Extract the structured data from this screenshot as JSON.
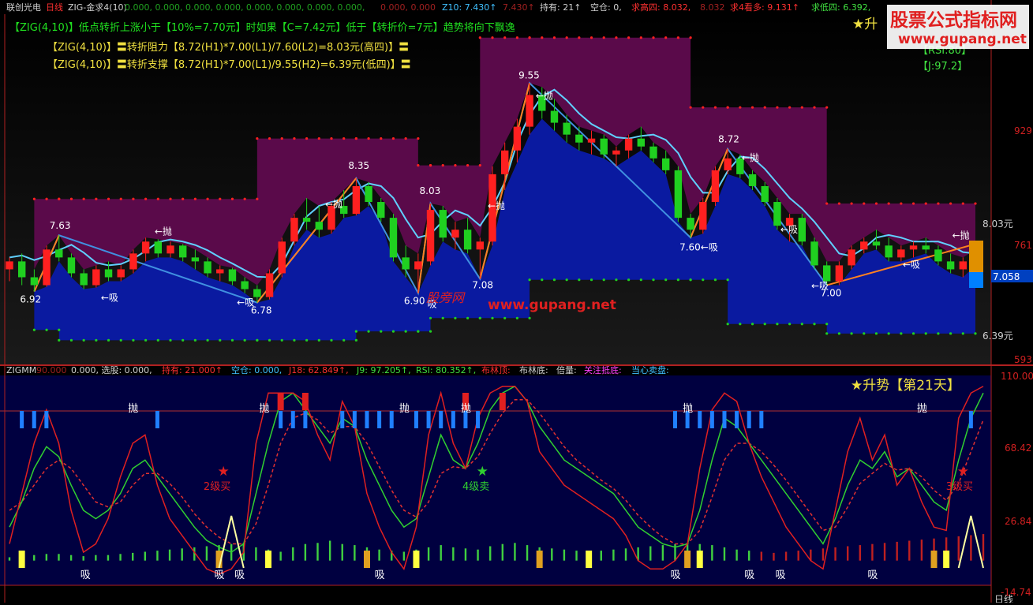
{
  "window": {
    "app_title": "联创光电",
    "period": "日线",
    "indicator_name": "ZIG-金求4(10)"
  },
  "top_bar": {
    "zero_values": "0.000, 0.000, 0.000, 0.000, 0.000, 0.000, 0.000, 0.000,",
    "zero_value_red": "0.000, 0.000",
    "z10": "Z10: 7.430↑",
    "z10_b": "7.430↑",
    "holding": "持有: 21↑",
    "empty": "空仓: 0,",
    "qiu_gao_si": "求高四: 8.032,",
    "qiu_gao_si_b": "8.032",
    "qiu_kan_duo": "求4看多: 9.131↑",
    "qiu_di_si": "求低四: 6.392,"
  },
  "watermark": {
    "title": "股票公式指标网",
    "url": "www.gupang.net",
    "mid_text": "股旁网",
    "mid_url": "www.gupang.net"
  },
  "notes": {
    "line1": "【ZIG(4,10)】低点转折上涨小于【10%=7.70元】时如果【C=7.42元】低于【转折价=7元】趋势将向下飘逸",
    "line2": "【ZIG(4,10)】〓转折阻力【8.72(H1)*7.00(L1)/7.60(L2)=8.03元(高四)】〓",
    "line3": "【ZIG(4,10)】〓转折支撑【8.72(H1)*7.00(L1)/9.55(H2)=6.39元(低四)】〓",
    "star_upper": "★升",
    "rsi": "【RSI:80】",
    "j": "【J:97.2】"
  },
  "right_axis_upper": {
    "val_929": "929",
    "val_803": "8.03元",
    "val_761": "761",
    "val_7058": "7.058",
    "val_639": "6.39元",
    "val_593": "593"
  },
  "lower_panel": {
    "name": "ZIGMM",
    "v90": "90.000",
    "xuangu": "0.000, 选股: 0.000,",
    "chiyou": "持有: 21.000↑",
    "kongcang": "空仓: 0.000,",
    "j18": "J18: 62.849↑,",
    "j9": "J9: 97.205↑,",
    "rsi": "RSI: 80.352↑,",
    "bulin_ding": "布林顶:",
    "bulin_di": "布林底:",
    "beiliang": "倍量:",
    "guanzhu": "关注抵底:",
    "dangxin": "当心卖盘:",
    "status": "★升势【第21天】",
    "axis_110": "110.00",
    "axis_6842": "68.42",
    "axis_2684": "26.84",
    "axis_neg": "-14.74",
    "bottom_right": "日线"
  },
  "labels_upper": [
    {
      "text": "7.63",
      "color": "#ffffff"
    },
    {
      "text": "6.92",
      "color": "#ffffff"
    },
    {
      "text": "←抛",
      "color": "#ffffff"
    },
    {
      "text": "←吸",
      "color": "#ffffff"
    },
    {
      "text": "6.78",
      "color": "#ffffff"
    },
    {
      "text": "←吸",
      "color": "#ffffff"
    },
    {
      "text": "8.35",
      "color": "#ffffff"
    },
    {
      "text": "←抛",
      "color": "#ffffff"
    },
    {
      "text": "8.03",
      "color": "#ffffff"
    },
    {
      "text": "6.90",
      "color": "#ffffff"
    },
    {
      "text": "吸",
      "color": "#ffffff"
    },
    {
      "text": "←抛",
      "color": "#ffffff"
    },
    {
      "text": "7.08",
      "color": "#ffffff"
    },
    {
      "text": "9.55",
      "color": "#ffffff"
    },
    {
      "text": "←抛",
      "color": "#ffffff"
    },
    {
      "text": "7.60←吸",
      "color": "#ffffff"
    },
    {
      "text": "8.72",
      "color": "#ffffff"
    },
    {
      "text": "←抛",
      "color": "#ffffff"
    },
    {
      "text": "←吸",
      "color": "#ffffff"
    },
    {
      "text": "←吸",
      "color": "#ffffff"
    },
    {
      "text": "7.00",
      "color": "#ffffff"
    },
    {
      "text": "←吸",
      "color": "#ffffff"
    },
    {
      "text": "←抛",
      "color": "#ffffff"
    }
  ],
  "labels_lower": [
    {
      "text": "抛"
    },
    {
      "text": "抛"
    },
    {
      "text": "抛"
    },
    {
      "text": "抛"
    },
    {
      "text": "抛"
    },
    {
      "text": "抛"
    },
    {
      "text": "吸"
    },
    {
      "text": "吸"
    },
    {
      "text": "吸"
    },
    {
      "text": "吸"
    },
    {
      "text": "吸"
    },
    {
      "text": "吸"
    },
    {
      "text": "吸"
    },
    {
      "text": "吸"
    },
    {
      "text": "2级买"
    },
    {
      "text": "4级卖"
    },
    {
      "text": "3级买"
    }
  ],
  "chart_data": {
    "type": "candlestick",
    "candles": [
      [
        7.2,
        7.35,
        7.05,
        7.3
      ],
      [
        7.3,
        7.4,
        7.0,
        7.1
      ],
      [
        7.1,
        7.2,
        6.92,
        7.0
      ],
      [
        7.0,
        7.5,
        6.98,
        7.45
      ],
      [
        7.45,
        7.63,
        7.3,
        7.35
      ],
      [
        7.35,
        7.4,
        7.1,
        7.15
      ],
      [
        7.15,
        7.2,
        6.95,
        7.0
      ],
      [
        7.0,
        7.25,
        6.97,
        7.2
      ],
      [
        7.2,
        7.3,
        7.05,
        7.1
      ],
      [
        7.1,
        7.25,
        7.05,
        7.2
      ],
      [
        7.2,
        7.45,
        7.15,
        7.4
      ],
      [
        7.4,
        7.6,
        7.3,
        7.55
      ],
      [
        7.55,
        7.58,
        7.35,
        7.4
      ],
      [
        7.4,
        7.55,
        7.35,
        7.5
      ],
      [
        7.5,
        7.52,
        7.3,
        7.35
      ],
      [
        7.35,
        7.45,
        7.2,
        7.3
      ],
      [
        7.3,
        7.35,
        7.1,
        7.15
      ],
      [
        7.15,
        7.25,
        7.05,
        7.2
      ],
      [
        7.2,
        7.22,
        7.0,
        7.05
      ],
      [
        7.05,
        7.1,
        6.9,
        6.95
      ],
      [
        6.95,
        7.0,
        6.78,
        6.85
      ],
      [
        6.85,
        7.2,
        6.82,
        7.15
      ],
      [
        7.15,
        7.6,
        7.1,
        7.55
      ],
      [
        7.55,
        7.9,
        7.5,
        7.85
      ],
      [
        7.85,
        8.1,
        7.7,
        7.8
      ],
      [
        7.8,
        8.0,
        7.6,
        7.7
      ],
      [
        7.7,
        8.05,
        7.65,
        8.0
      ],
      [
        8.0,
        8.2,
        7.85,
        7.9
      ],
      [
        7.9,
        8.35,
        7.88,
        8.25
      ],
      [
        8.25,
        8.3,
        8.0,
        8.05
      ],
      [
        8.05,
        8.1,
        7.8,
        7.85
      ],
      [
        7.85,
        7.9,
        7.3,
        7.35
      ],
      [
        7.35,
        7.5,
        7.1,
        7.2
      ],
      [
        7.2,
        7.4,
        6.9,
        7.3
      ],
      [
        7.3,
        8.03,
        7.25,
        7.95
      ],
      [
        7.95,
        8.0,
        7.55,
        7.6
      ],
      [
        7.6,
        7.8,
        7.45,
        7.7
      ],
      [
        7.7,
        7.85,
        7.4,
        7.45
      ],
      [
        7.45,
        7.6,
        7.08,
        7.55
      ],
      [
        7.55,
        8.5,
        7.5,
        8.4
      ],
      [
        8.4,
        8.8,
        8.2,
        8.7
      ],
      [
        8.7,
        9.1,
        8.55,
        9.0
      ],
      [
        9.0,
        9.55,
        8.9,
        9.4
      ],
      [
        9.4,
        9.5,
        9.1,
        9.2
      ],
      [
        9.2,
        9.35,
        8.95,
        9.05
      ],
      [
        9.05,
        9.15,
        8.8,
        8.9
      ],
      [
        8.9,
        9.0,
        8.7,
        8.8
      ],
      [
        8.8,
        8.95,
        8.65,
        8.85
      ],
      [
        8.85,
        8.9,
        8.6,
        8.65
      ],
      [
        8.65,
        8.75,
        8.5,
        8.7
      ],
      [
        8.7,
        8.9,
        8.6,
        8.85
      ],
      [
        8.85,
        9.0,
        8.7,
        8.75
      ],
      [
        8.75,
        8.8,
        8.55,
        8.6
      ],
      [
        8.6,
        8.7,
        8.4,
        8.45
      ],
      [
        8.45,
        8.5,
        7.8,
        7.85
      ],
      [
        7.85,
        7.9,
        7.6,
        7.7
      ],
      [
        7.7,
        8.1,
        7.65,
        8.05
      ],
      [
        8.05,
        8.5,
        8.0,
        8.45
      ],
      [
        8.45,
        8.72,
        8.4,
        8.6
      ],
      [
        8.6,
        8.65,
        8.35,
        8.4
      ],
      [
        8.4,
        8.45,
        8.2,
        8.25
      ],
      [
        8.25,
        8.3,
        8.0,
        8.05
      ],
      [
        8.05,
        8.1,
        7.7,
        7.75
      ],
      [
        7.75,
        7.9,
        7.55,
        7.85
      ],
      [
        7.85,
        7.9,
        7.5,
        7.55
      ],
      [
        7.55,
        7.6,
        7.2,
        7.25
      ],
      [
        7.25,
        7.3,
        7.0,
        7.05
      ],
      [
        7.05,
        7.3,
        7.0,
        7.25
      ],
      [
        7.25,
        7.5,
        7.2,
        7.45
      ],
      [
        7.45,
        7.6,
        7.4,
        7.55
      ],
      [
        7.55,
        7.7,
        7.45,
        7.5
      ],
      [
        7.5,
        7.6,
        7.3,
        7.35
      ],
      [
        7.35,
        7.5,
        7.3,
        7.45
      ],
      [
        7.45,
        7.55,
        7.35,
        7.5
      ],
      [
        7.5,
        7.6,
        7.4,
        7.45
      ],
      [
        7.45,
        7.5,
        7.25,
        7.3
      ],
      [
        7.3,
        7.4,
        7.15,
        7.2
      ],
      [
        7.2,
        7.35,
        7.1,
        7.3
      ],
      [
        7.3,
        7.45,
        7.25,
        7.42
      ]
    ],
    "zig_pivots": [
      {
        "i": 2,
        "v": 6.92
      },
      {
        "i": 4,
        "v": 7.63
      },
      {
        "i": 20,
        "v": 6.78
      },
      {
        "i": 28,
        "v": 8.35
      },
      {
        "i": 33,
        "v": 6.9
      },
      {
        "i": 34,
        "v": 8.03
      },
      {
        "i": 38,
        "v": 7.08
      },
      {
        "i": 42,
        "v": 9.55
      },
      {
        "i": 55,
        "v": 7.6
      },
      {
        "i": 58,
        "v": 8.72
      },
      {
        "i": 66,
        "v": 7.0
      }
    ],
    "ylim": [
      6.0,
      10.3
    ],
    "support_level": 6.39,
    "resistance_level": 8.03,
    "lower": {
      "ylim": [
        -14.74,
        110.0
      ],
      "threshold": 90,
      "k_line": [
        20,
        35,
        55,
        68,
        62,
        45,
        30,
        25,
        30,
        40,
        55,
        60,
        50,
        40,
        30,
        20,
        12,
        8,
        5,
        10,
        40,
        70,
        95,
        100,
        90,
        80,
        70,
        85,
        80,
        60,
        45,
        30,
        20,
        25,
        50,
        75,
        60,
        55,
        70,
        90,
        100,
        104,
        95,
        80,
        70,
        60,
        55,
        50,
        45,
        40,
        30,
        20,
        15,
        10,
        8,
        10,
        30,
        60,
        85,
        80,
        70,
        60,
        50,
        40,
        30,
        20,
        10,
        25,
        45,
        60,
        55,
        65,
        50,
        55,
        45,
        35,
        30,
        60,
        85,
        100
      ],
      "d_line": [
        30,
        35,
        45,
        55,
        60,
        55,
        45,
        35,
        32,
        35,
        45,
        52,
        52,
        46,
        38,
        28,
        20,
        14,
        10,
        10,
        22,
        45,
        70,
        85,
        88,
        84,
        76,
        80,
        80,
        70,
        56,
        42,
        30,
        26,
        35,
        52,
        56,
        55,
        62,
        76,
        88,
        96,
        96,
        88,
        78,
        68,
        60,
        54,
        48,
        43,
        36,
        27,
        20,
        14,
        10,
        10,
        18,
        38,
        60,
        70,
        70,
        65,
        57,
        48,
        38,
        28,
        18,
        20,
        32,
        46,
        52,
        58,
        54,
        55,
        50,
        42,
        36,
        46,
        65,
        84
      ],
      "j_line": [
        10,
        40,
        70,
        90,
        70,
        30,
        5,
        10,
        25,
        50,
        70,
        75,
        45,
        25,
        15,
        5,
        -5,
        -8,
        -5,
        5,
        70,
        100,
        100,
        100,
        95,
        75,
        60,
        95,
        80,
        40,
        20,
        5,
        -5,
        20,
        75,
        100,
        70,
        55,
        85,
        100,
        104,
        104,
        95,
        65,
        55,
        45,
        40,
        35,
        30,
        25,
        15,
        0,
        -5,
        -5,
        0,
        10,
        55,
        90,
        100,
        95,
        70,
        50,
        35,
        20,
        10,
        0,
        -5,
        30,
        65,
        85,
        60,
        75,
        45,
        55,
        35,
        20,
        18,
        85,
        100,
        104
      ],
      "volume": [
        3,
        4,
        5,
        6,
        6,
        5,
        4,
        5,
        5,
        6,
        7,
        8,
        9,
        10,
        11,
        12,
        13,
        14,
        15,
        16,
        12,
        10,
        8,
        12,
        15,
        16,
        18,
        15,
        14,
        12,
        10,
        9,
        8,
        10,
        12,
        14,
        12,
        11,
        10,
        13,
        15,
        16,
        14,
        12,
        11,
        10,
        9,
        8,
        9,
        10,
        11,
        12,
        13,
        14,
        15,
        16,
        15,
        14,
        12,
        10,
        9,
        8,
        7,
        8,
        9,
        10,
        11,
        12,
        13,
        14,
        15,
        16,
        17,
        18,
        19,
        20,
        21,
        22,
        23,
        24
      ]
    }
  }
}
